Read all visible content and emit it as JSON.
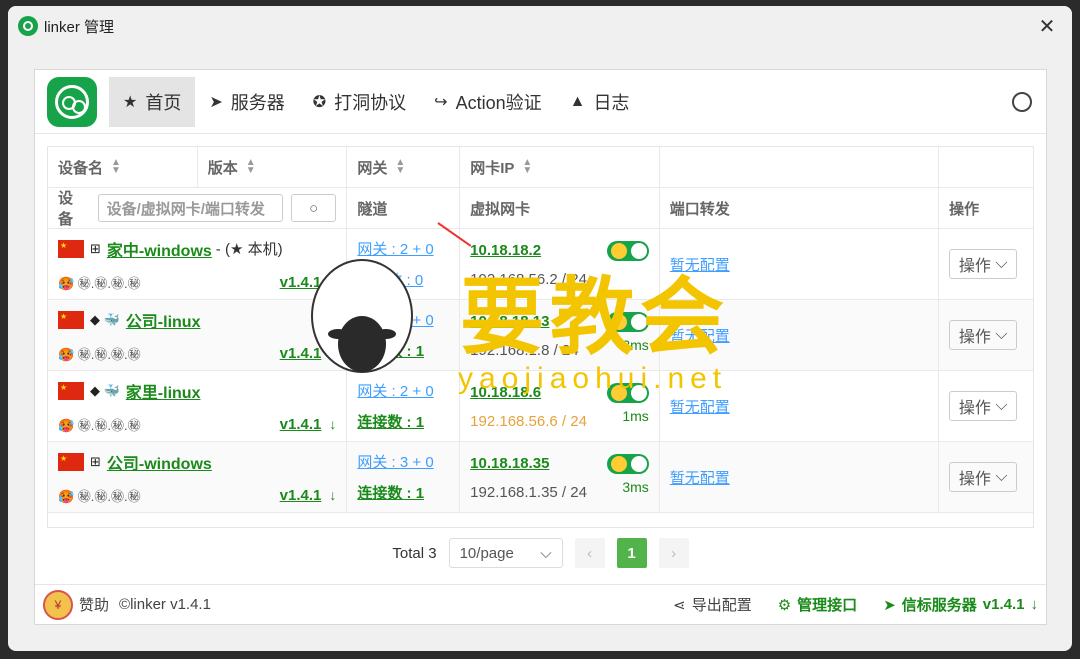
{
  "window": {
    "title": "linker 管理",
    "close": "✕"
  },
  "nav": {
    "tabs": [
      {
        "label": "首页",
        "icon": "★"
      },
      {
        "label": "服务器",
        "icon": "➤"
      },
      {
        "label": "打洞协议",
        "icon": "✪"
      },
      {
        "label": "Action验证",
        "icon": "↪"
      },
      {
        "label": "日志",
        "icon": "▲"
      }
    ]
  },
  "table": {
    "headers": [
      "设备名",
      "版本",
      "网关",
      "网卡IP",
      "",
      ""
    ],
    "subheaders": {
      "device": "设备",
      "search_placeholder": "设备/虚拟网卡/端口转发",
      "tunnel": "隧道",
      "vnic": "虚拟网卡",
      "port": "端口转发",
      "op": "操作"
    },
    "rows": [
      {
        "name": "家中-windows",
        "self": "- (★ 本机)",
        "icons": "⊞",
        "emoji": "🥵 ㊙.㊙.㊙.㊙",
        "version": "v1.4.1",
        "gateway": "网关 : 2 + 0",
        "conn": "连接数 : 0",
        "ip": "10.18.18.2",
        "lan": "192.168.56.2 / 24",
        "ms": "",
        "port": "暂无配置",
        "op": "操作"
      },
      {
        "name": "公司-linux",
        "self": "",
        "icons": "◆ 🐳",
        "emoji": "🥵 ㊙.㊙.㊙.㊙",
        "version": "v1.4.1",
        "gateway": "网关 : 3 + 0",
        "conn": "连接数 : 1",
        "ip": "10.18.18.13",
        "lan": "192.168.1.8 / 24",
        "ms": "3ms",
        "port": "暂无配置",
        "op": "操作"
      },
      {
        "name": "家里-linux",
        "self": "",
        "icons": "◆ 🐳",
        "emoji": "🥵 ㊙.㊙.㊙.㊙",
        "version": "v1.4.1",
        "gateway": "网关 : 2 + 0",
        "conn": "连接数 : 1",
        "ip": "10.18.18.6",
        "lan": "192.168.56.6 / 24",
        "ms": "1ms",
        "port": "暂无配置",
        "op": "操作"
      },
      {
        "name": "公司-windows",
        "self": "",
        "icons": "⊞",
        "emoji": "🥵 ㊙.㊙.㊙.㊙",
        "version": "v1.4.1",
        "gateway": "网关 : 3 + 0",
        "conn": "连接数 : 1",
        "ip": "10.18.18.35",
        "lan": "192.168.1.35 / 24",
        "ms": "3ms",
        "port": "暂无配置",
        "op": "操作"
      }
    ]
  },
  "pager": {
    "total": "Total 3",
    "page_size": "10/page",
    "current": "1"
  },
  "footer": {
    "donate": "赞助",
    "copyright": "©linker v1.4.1",
    "export": "导出配置",
    "api": "管理接口",
    "server": "信标服务器",
    "server_version": "v1.4.1"
  },
  "watermark": {
    "main": "要教会",
    "sub": "yaojiaohui.net"
  }
}
